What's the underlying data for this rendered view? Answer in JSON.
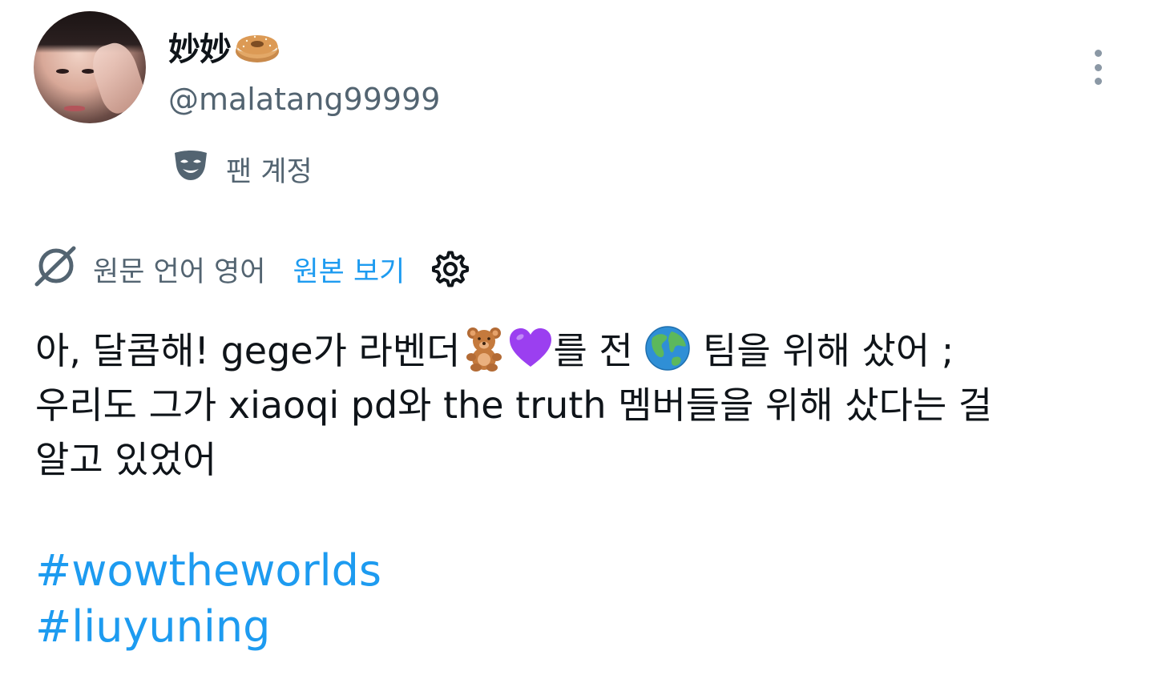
{
  "author": {
    "display_name": "妙妙",
    "name_emoji": "bagel-emoji",
    "handle": "@malatang99999",
    "account_label": "팬 계정",
    "account_label_icon": "theater-mask-icon"
  },
  "menu": {
    "icon": "more-vertical-icon"
  },
  "translation": {
    "icon": "translate-icon",
    "label": "원문 언어 영어",
    "show_original": "원본 보기",
    "settings_icon": "gear-icon"
  },
  "tweet": {
    "line1_a": "아, 달콤해! gege가 라벤더",
    "line1_b": "를 전",
    "line1_c": "팀을 위해 샀어 ;",
    "line2": "우리도 그가 xiaoqi pd와 the truth 멤버들을 위해 샀다는 걸",
    "line3": "알고 있었어",
    "emojis": [
      "teddy-bear-emoji",
      "purple-heart-emoji",
      "globe-emoji"
    ]
  },
  "hashtags": [
    "#wowtheworlds",
    "#liuyuning"
  ],
  "colors": {
    "link": "#1d9bf0",
    "muted": "#536471",
    "text": "#0f1419"
  }
}
